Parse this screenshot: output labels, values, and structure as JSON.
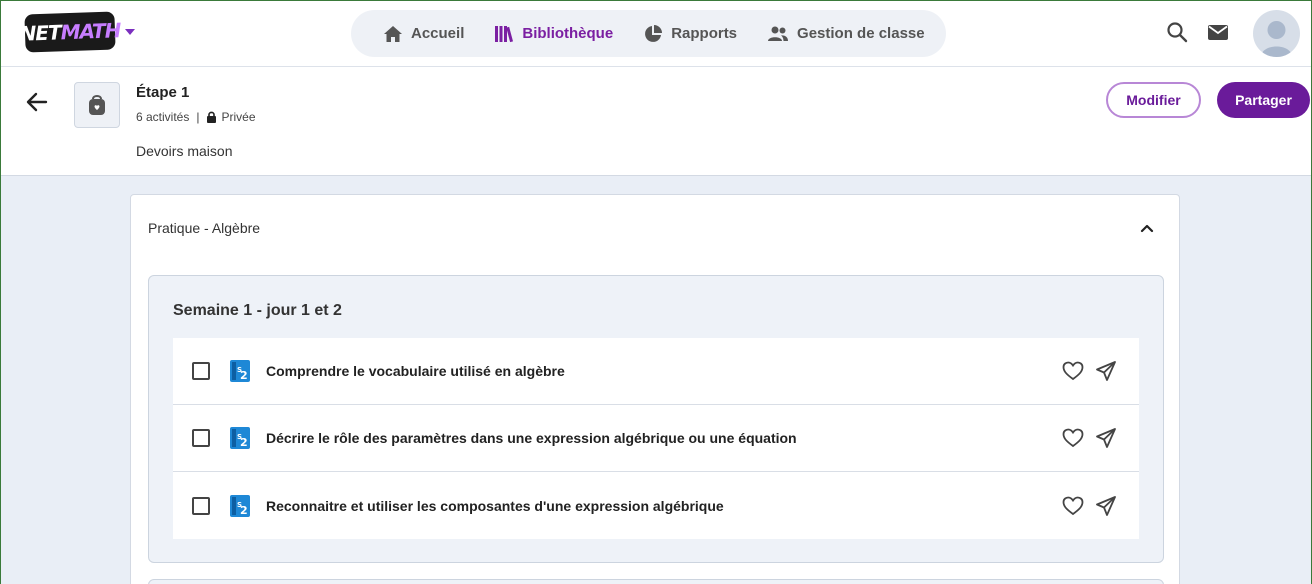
{
  "app": {
    "logo_text_a": "NET",
    "logo_text_b": "MATH"
  },
  "nav": {
    "items": [
      {
        "label": "Accueil",
        "icon": "home-icon",
        "active": false
      },
      {
        "label": "Bibliothèque",
        "icon": "library-icon",
        "active": true
      },
      {
        "label": "Rapports",
        "icon": "pie-chart-icon",
        "active": false
      },
      {
        "label": "Gestion de classe",
        "icon": "users-icon",
        "active": false
      }
    ]
  },
  "header": {
    "title": "Étape 1",
    "activity_count": "6 activités",
    "separator": "|",
    "visibility": "Privée",
    "description": "Devoirs maison",
    "modifier_label": "Modifier",
    "partager_label": "Partager"
  },
  "section": {
    "title": "Pratique - Algèbre",
    "week": {
      "title": "Semaine 1 - jour 1 et 2",
      "badge": "S2",
      "activities": [
        {
          "label": "Comprendre le vocabulaire utilisé en algèbre"
        },
        {
          "label": "Décrire le rôle des paramètres dans une expression algébrique ou une équation"
        },
        {
          "label": "Reconnaitre et utiliser les composantes d'une expression algébrique"
        }
      ]
    }
  },
  "colors": {
    "accent": "#6a1b9a",
    "active_nav": "#7b1fa2",
    "badge_blue": "#1e88d6"
  }
}
